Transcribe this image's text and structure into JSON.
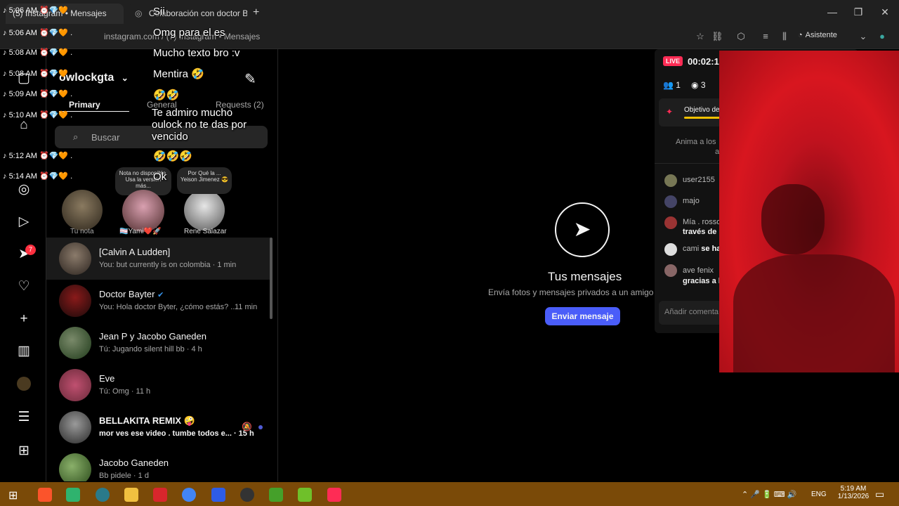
{
  "browser": {
    "tabs": [
      {
        "label": "(5) Instagram • Mensajes"
      },
      {
        "label": "Colaboración con doctor Biter"
      }
    ],
    "new_tab": "+",
    "address": "instagram.com / (7) Instagram • Mensajes",
    "assistant_label": "Asistente"
  },
  "instagram": {
    "username": "owlockgta",
    "tabs": [
      "Primary",
      "General",
      "Requests (2)"
    ],
    "search_placeholder": "Buscar",
    "notes": [
      {
        "bubble": "Nota no disponible. Usa la versión más...",
        "name": "Tu nota"
      },
      {
        "bubble": "",
        "name": "🏳️‍⚧️Yami❤️🚀"
      },
      {
        "bubble": "Por Qué la ... Yeison Jimenez 😎",
        "name": "Rene Salazar"
      }
    ],
    "notification_badge": "7",
    "conversations": [
      {
        "name": "[Calvin A Ludden]",
        "preview": "You: but currently is on colombia · 1 min",
        "time": ""
      },
      {
        "name": "Doctor Bayter",
        "preview": "You: Hola doctor Byter, ¿cómo estás? ...",
        "time": "11 min"
      },
      {
        "name": "Jean P y Jacobo Ganeden",
        "preview": "Tú: Jugando silent hill bb · 4 h",
        "time": ""
      },
      {
        "name": "Eve",
        "preview": "Tú: Omg · 11 h",
        "time": ""
      },
      {
        "name": "BELLAKITA REMIX 🤪",
        "preview": "mor ves ese video . tumbe todos e... · 15 h",
        "time": ""
      },
      {
        "name": "Jacobo Ganeden",
        "preview": "Bb pidele · 1 d",
        "time": ""
      }
    ],
    "empty_state": {
      "title": "Tus mensajes",
      "subtitle": "Envía fotos y mensajes privados a un amigo o grupo",
      "button": "Enviar mensaje"
    }
  },
  "live_panel": {
    "badge": "LIVE",
    "timer": "00:02:1",
    "viewers_people": "1",
    "viewers_eye": "3",
    "goal": "Objetivo de",
    "hint": "Anima a los",
    "hint2": "a",
    "chat": [
      {
        "user": "user2155",
        "text": ""
      },
      {
        "user": "majo",
        "text": ""
      },
      {
        "user": "Mía . rosso",
        "text": "través de"
      },
      {
        "user": "cami",
        "text": "se ha"
      },
      {
        "user": "ave fenix",
        "text": "gracias a l"
      }
    ],
    "comment_placeholder": "Añadir comenta"
  },
  "tiktok_overlay": {
    "rows": [
      {
        "time": "5:06 AM",
        "msg": "Sii"
      },
      {
        "time": "5:06 AM",
        "msg": "Omg para el es"
      },
      {
        "time": "5:08 AM",
        "msg": "Mucho texto bro :v"
      },
      {
        "time": "5:08 AM",
        "msg": "Mentira 🤣"
      },
      {
        "time": "5:09 AM",
        "msg": "🤣🤣"
      },
      {
        "time": "5:10 AM",
        "msg": "Te admiro mucho oulock no te das por vencido"
      },
      {
        "time": "5:12 AM",
        "msg": "🤣🤣🤣"
      },
      {
        "time": "5:14 AM",
        "msg": "Ok"
      }
    ]
  },
  "taskbar": {
    "lang": "ENG",
    "time": "5:19 AM",
    "date": "1/13/2026"
  },
  "colors": {
    "accent_blue": "#4f5bd5",
    "instagram_button": "#4a5df9",
    "live_red": "#fe2c55",
    "taskbar": "#7a4a08"
  }
}
